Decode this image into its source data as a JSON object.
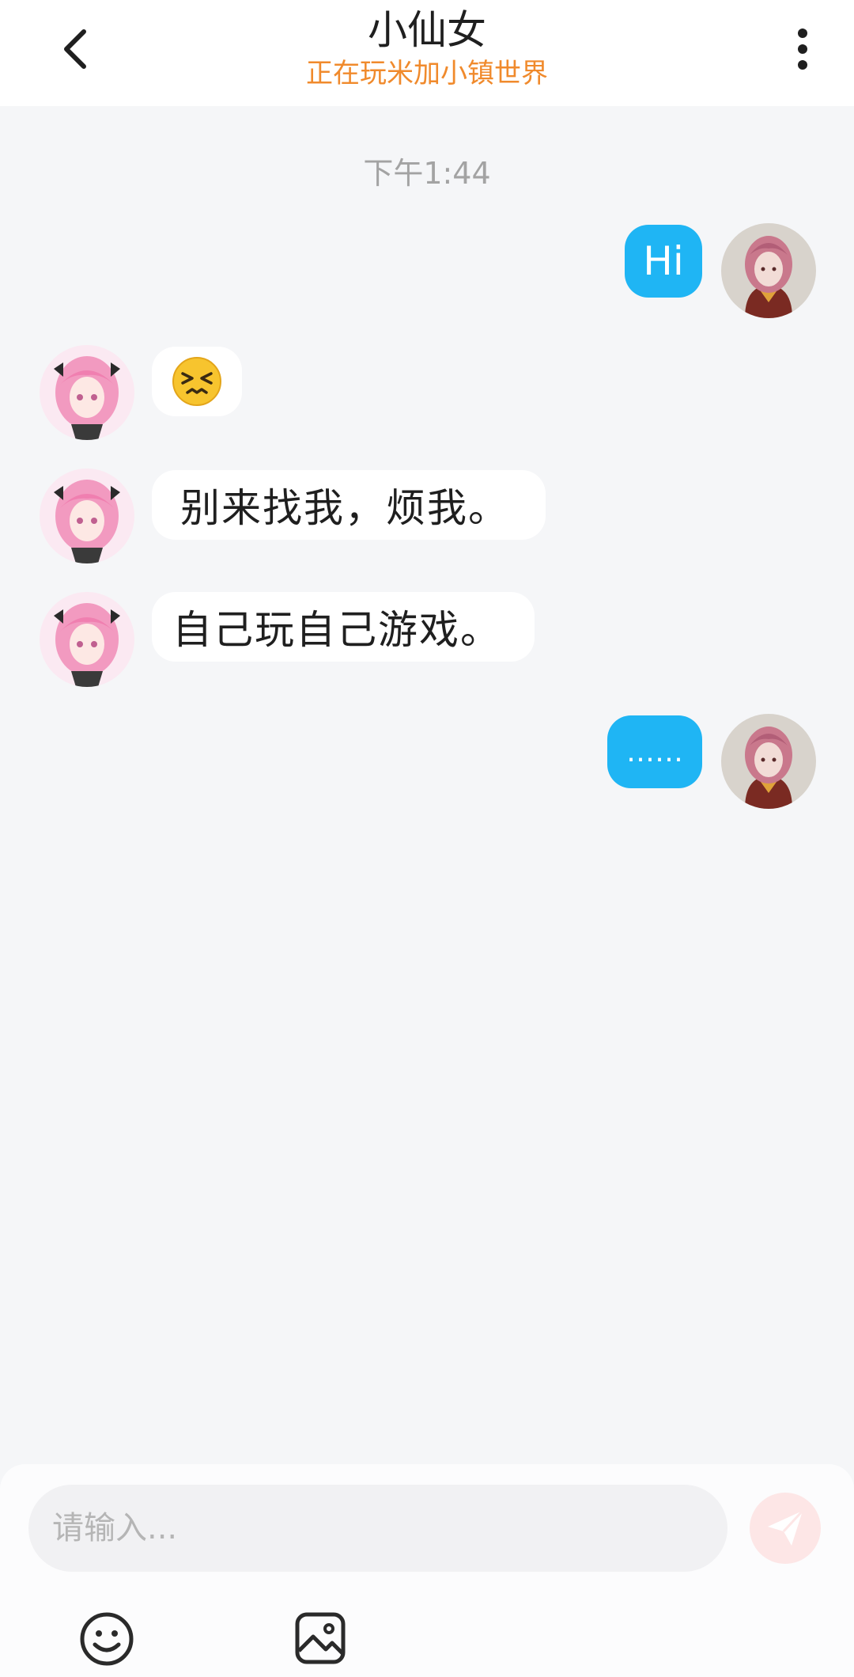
{
  "header": {
    "title": "小仙女",
    "status": "正在玩米加小镇世界",
    "back_icon": "chevron-left-icon",
    "more_icon": "more-vertical-icon"
  },
  "chat": {
    "timestamp": "下午1:44",
    "messages": [
      {
        "side": "out",
        "type": "text",
        "text": "Hi"
      },
      {
        "side": "in",
        "type": "emoji",
        "emoji": "persevering-face"
      },
      {
        "side": "in",
        "type": "text",
        "text": "别来找我，烦我。"
      },
      {
        "side": "in",
        "type": "text",
        "text": "自己玩自己游戏。"
      },
      {
        "side": "out",
        "type": "text",
        "text": "……"
      }
    ]
  },
  "composer": {
    "placeholder": "请输入...",
    "send_icon": "send-icon",
    "emoji_icon": "smiley-icon",
    "image_icon": "image-icon"
  },
  "colors": {
    "accent_status": "#f08a2c",
    "outgoing_bubble": "#1fb5f4",
    "incoming_bubble": "#ffffff",
    "background": "#f5f6f8",
    "send_button": "#fde6e6"
  }
}
